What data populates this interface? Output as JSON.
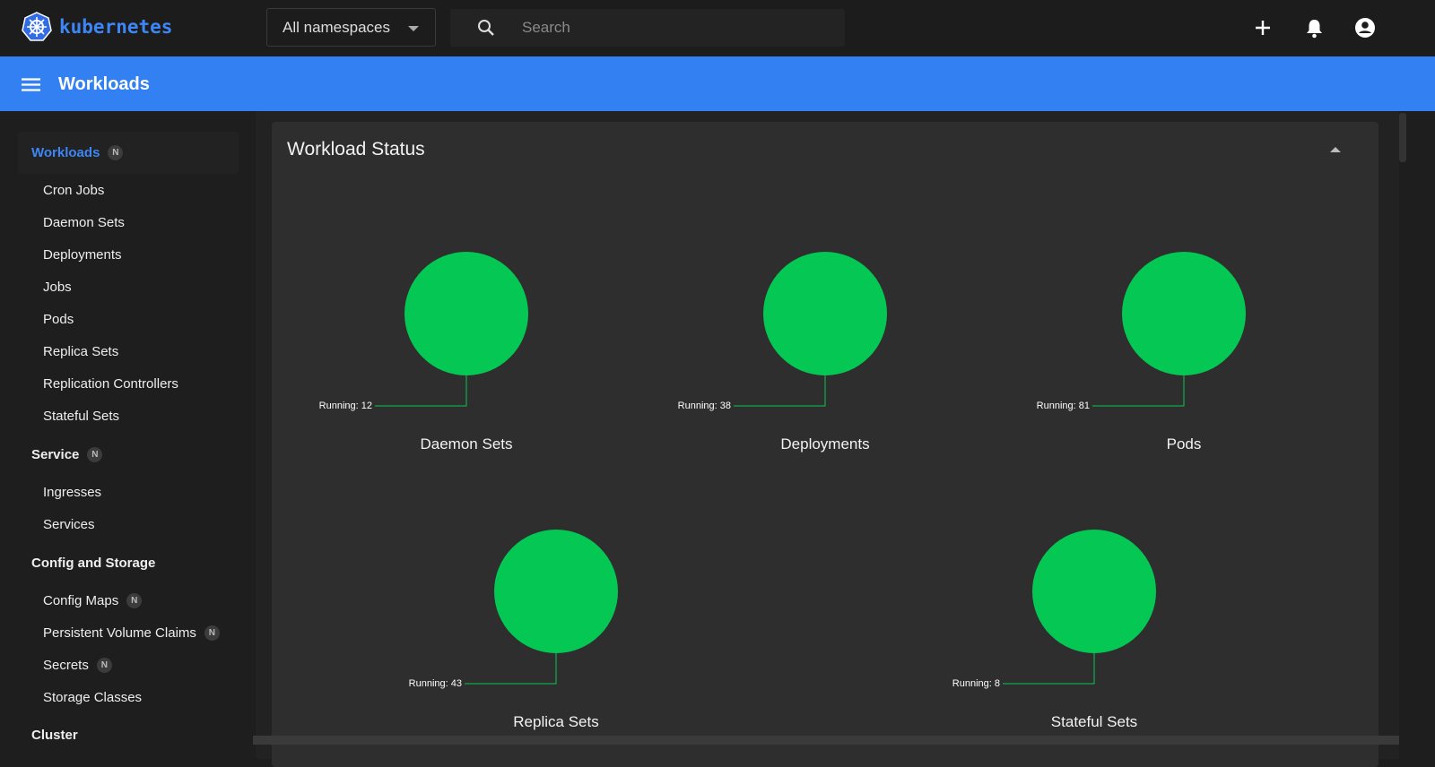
{
  "header": {
    "logo_text": "kubernetes",
    "namespace": "All namespaces",
    "search_placeholder": "Search"
  },
  "toolbar": {
    "title": "Workloads"
  },
  "sidebar": {
    "sections": [
      {
        "label": "Workloads",
        "badge": "N",
        "active": true,
        "items": [
          {
            "label": "Cron Jobs"
          },
          {
            "label": "Daemon Sets"
          },
          {
            "label": "Deployments"
          },
          {
            "label": "Jobs"
          },
          {
            "label": "Pods"
          },
          {
            "label": "Replica Sets"
          },
          {
            "label": "Replication Controllers"
          },
          {
            "label": "Stateful Sets"
          }
        ]
      },
      {
        "label": "Service",
        "badge": "N",
        "items": [
          {
            "label": "Ingresses"
          },
          {
            "label": "Services"
          }
        ]
      },
      {
        "label": "Config and Storage",
        "items": [
          {
            "label": "Config Maps",
            "badge": "N"
          },
          {
            "label": "Persistent Volume Claims",
            "badge": "N"
          },
          {
            "label": "Secrets",
            "badge": "N"
          },
          {
            "label": "Storage Classes"
          }
        ]
      },
      {
        "label": "Cluster"
      }
    ]
  },
  "card": {
    "title": "Workload Status"
  },
  "colors": {
    "running": "#05c753",
    "accent": "#3280f2"
  },
  "chart_data": [
    {
      "type": "pie",
      "title": "Daemon Sets",
      "slices": [
        {
          "label": "Running",
          "value": 12
        }
      ],
      "label_text": "Running: 12"
    },
    {
      "type": "pie",
      "title": "Deployments",
      "slices": [
        {
          "label": "Running",
          "value": 38
        }
      ],
      "label_text": "Running: 38"
    },
    {
      "type": "pie",
      "title": "Pods",
      "slices": [
        {
          "label": "Running",
          "value": 81
        }
      ],
      "label_text": "Running: 81"
    },
    {
      "type": "pie",
      "title": "Replica Sets",
      "slices": [
        {
          "label": "Running",
          "value": 43
        }
      ],
      "label_text": "Running: 43"
    },
    {
      "type": "pie",
      "title": "Stateful Sets",
      "slices": [
        {
          "label": "Running",
          "value": 8
        }
      ],
      "label_text": "Running: 8"
    }
  ]
}
